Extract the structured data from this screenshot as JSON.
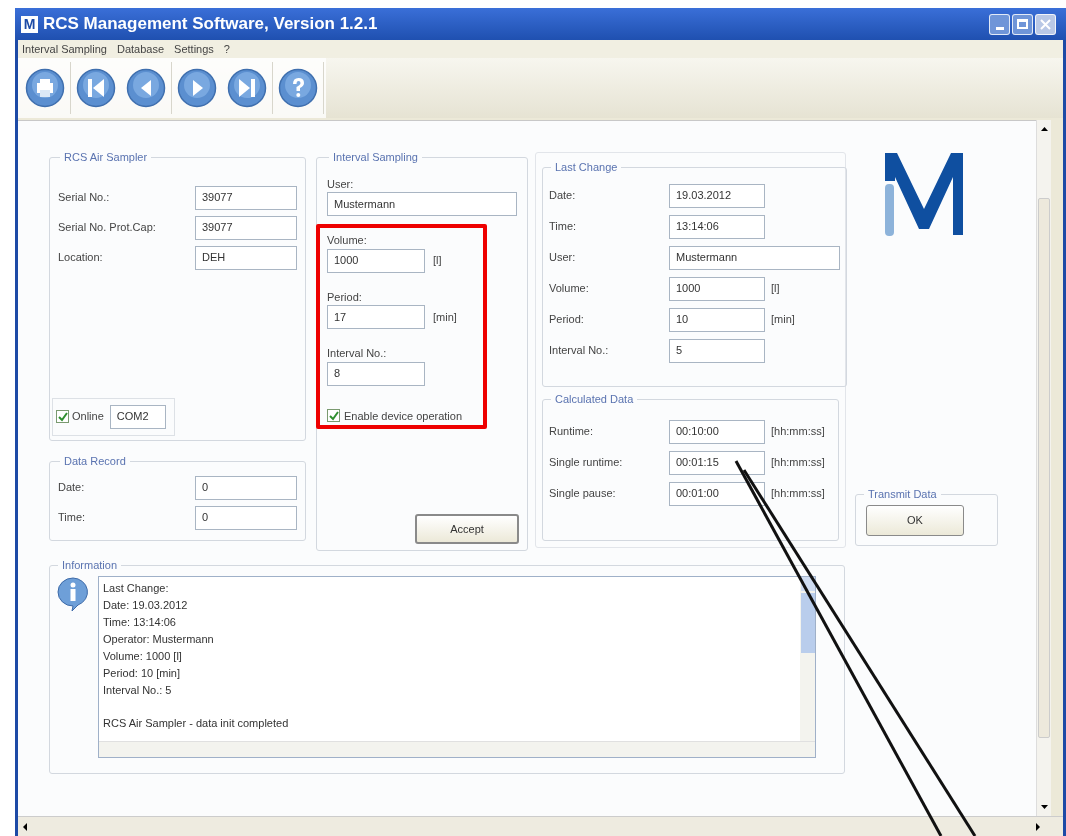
{
  "window": {
    "app_icon_letter": "M",
    "title": "RCS Management Software, Version 1.2.1"
  },
  "menu": [
    "Interval Sampling",
    "Database",
    "Settings",
    "?"
  ],
  "toolbar": [
    {
      "kind": "print",
      "separator_after": true
    },
    {
      "kind": "first",
      "separator_after": false
    },
    {
      "kind": "previous",
      "separator_after": true
    },
    {
      "kind": "next",
      "separator_after": false
    },
    {
      "kind": "last",
      "separator_after": true
    },
    {
      "kind": "help",
      "separator_after": true
    }
  ],
  "rcs_air_sampler": {
    "title": "RCS Air Sampler",
    "fields": [
      {
        "label": "Serial No.:",
        "value": "39077"
      },
      {
        "label": "Serial No. Prot.Cap:",
        "value": "39077"
      },
      {
        "label": "Location:",
        "value": "DEH"
      }
    ],
    "online": {
      "label": "Online",
      "checked": true,
      "port": "COM2"
    }
  },
  "data_record": {
    "title": "Data Record",
    "fields": [
      {
        "label": "Date:",
        "value": "0"
      },
      {
        "label": "Time:",
        "value": "0"
      }
    ]
  },
  "interval_sampling": {
    "title": "Interval Sampling",
    "user": {
      "label": "User:",
      "value": "Mustermann"
    },
    "fields": [
      {
        "label": "Volume:",
        "value": "1000",
        "unit": "[l]"
      },
      {
        "label": "Period:",
        "value": "17",
        "unit": "[min]"
      },
      {
        "label": "Interval No.:",
        "value": "8"
      }
    ],
    "enable_device": {
      "label": "Enable device operation",
      "checked": true
    },
    "accept_button": "Accept"
  },
  "last_change": {
    "title": "Last Change",
    "fields": [
      {
        "label": "Date:",
        "value": "19.03.2012",
        "wide": false
      },
      {
        "label": "Time:",
        "value": "13:14:06",
        "wide": false
      },
      {
        "label": "User:",
        "value": "Mustermann",
        "wide": true
      },
      {
        "label": "Volume:",
        "value": "1000",
        "unit": "[l]",
        "wide": false
      },
      {
        "label": "Period:",
        "value": "10",
        "unit": "[min]",
        "wide": false
      },
      {
        "label": "Interval No.:",
        "value": "5",
        "wide": false
      }
    ]
  },
  "calculated_data": {
    "title": "Calculated Data",
    "fields": [
      {
        "label": "Runtime:",
        "value": "00:10:00",
        "unit": "[hh:mm:ss]"
      },
      {
        "label": "Single runtime:",
        "value": "00:01:15",
        "unit": "[hh:mm:ss]"
      },
      {
        "label": "Single pause:",
        "value": "00:01:00",
        "unit": "[hh:mm:ss]"
      }
    ]
  },
  "transmit_data": {
    "title": "Transmit Data",
    "button": "OK"
  },
  "information": {
    "title": "Information",
    "paragraphs": [
      [
        "Last Change:",
        "Date: 19.03.2012",
        "Time: 13:14:06",
        "Operator: Mustermann",
        "Volume: 1000 [l]",
        "Period: 10 [min]",
        "Interval No.: 5"
      ],
      [
        "RCS Air Sampler - data init completed"
      ]
    ]
  }
}
